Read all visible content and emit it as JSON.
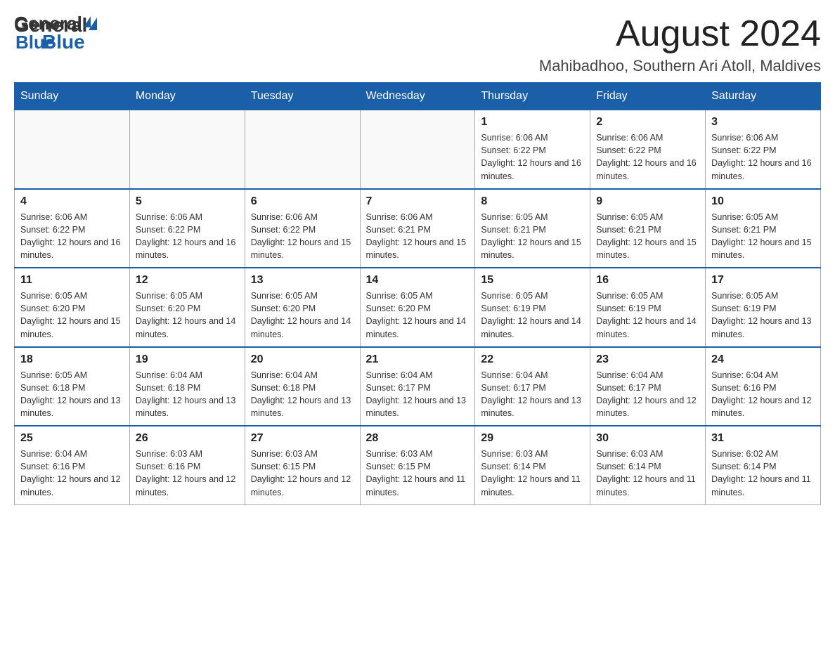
{
  "header": {
    "logo_general": "General",
    "logo_blue": "Blue",
    "month_title": "August 2024",
    "location": "Mahibadhoo, Southern Ari Atoll, Maldives"
  },
  "days_of_week": [
    "Sunday",
    "Monday",
    "Tuesday",
    "Wednesday",
    "Thursday",
    "Friday",
    "Saturday"
  ],
  "weeks": [
    [
      {
        "day": "",
        "sunrise": "",
        "sunset": "",
        "daylight": ""
      },
      {
        "day": "",
        "sunrise": "",
        "sunset": "",
        "daylight": ""
      },
      {
        "day": "",
        "sunrise": "",
        "sunset": "",
        "daylight": ""
      },
      {
        "day": "",
        "sunrise": "",
        "sunset": "",
        "daylight": ""
      },
      {
        "day": "1",
        "sunrise": "Sunrise: 6:06 AM",
        "sunset": "Sunset: 6:22 PM",
        "daylight": "Daylight: 12 hours and 16 minutes."
      },
      {
        "day": "2",
        "sunrise": "Sunrise: 6:06 AM",
        "sunset": "Sunset: 6:22 PM",
        "daylight": "Daylight: 12 hours and 16 minutes."
      },
      {
        "day": "3",
        "sunrise": "Sunrise: 6:06 AM",
        "sunset": "Sunset: 6:22 PM",
        "daylight": "Daylight: 12 hours and 16 minutes."
      }
    ],
    [
      {
        "day": "4",
        "sunrise": "Sunrise: 6:06 AM",
        "sunset": "Sunset: 6:22 PM",
        "daylight": "Daylight: 12 hours and 16 minutes."
      },
      {
        "day": "5",
        "sunrise": "Sunrise: 6:06 AM",
        "sunset": "Sunset: 6:22 PM",
        "daylight": "Daylight: 12 hours and 16 minutes."
      },
      {
        "day": "6",
        "sunrise": "Sunrise: 6:06 AM",
        "sunset": "Sunset: 6:22 PM",
        "daylight": "Daylight: 12 hours and 15 minutes."
      },
      {
        "day": "7",
        "sunrise": "Sunrise: 6:06 AM",
        "sunset": "Sunset: 6:21 PM",
        "daylight": "Daylight: 12 hours and 15 minutes."
      },
      {
        "day": "8",
        "sunrise": "Sunrise: 6:05 AM",
        "sunset": "Sunset: 6:21 PM",
        "daylight": "Daylight: 12 hours and 15 minutes."
      },
      {
        "day": "9",
        "sunrise": "Sunrise: 6:05 AM",
        "sunset": "Sunset: 6:21 PM",
        "daylight": "Daylight: 12 hours and 15 minutes."
      },
      {
        "day": "10",
        "sunrise": "Sunrise: 6:05 AM",
        "sunset": "Sunset: 6:21 PM",
        "daylight": "Daylight: 12 hours and 15 minutes."
      }
    ],
    [
      {
        "day": "11",
        "sunrise": "Sunrise: 6:05 AM",
        "sunset": "Sunset: 6:20 PM",
        "daylight": "Daylight: 12 hours and 15 minutes."
      },
      {
        "day": "12",
        "sunrise": "Sunrise: 6:05 AM",
        "sunset": "Sunset: 6:20 PM",
        "daylight": "Daylight: 12 hours and 14 minutes."
      },
      {
        "day": "13",
        "sunrise": "Sunrise: 6:05 AM",
        "sunset": "Sunset: 6:20 PM",
        "daylight": "Daylight: 12 hours and 14 minutes."
      },
      {
        "day": "14",
        "sunrise": "Sunrise: 6:05 AM",
        "sunset": "Sunset: 6:20 PM",
        "daylight": "Daylight: 12 hours and 14 minutes."
      },
      {
        "day": "15",
        "sunrise": "Sunrise: 6:05 AM",
        "sunset": "Sunset: 6:19 PM",
        "daylight": "Daylight: 12 hours and 14 minutes."
      },
      {
        "day": "16",
        "sunrise": "Sunrise: 6:05 AM",
        "sunset": "Sunset: 6:19 PM",
        "daylight": "Daylight: 12 hours and 14 minutes."
      },
      {
        "day": "17",
        "sunrise": "Sunrise: 6:05 AM",
        "sunset": "Sunset: 6:19 PM",
        "daylight": "Daylight: 12 hours and 13 minutes."
      }
    ],
    [
      {
        "day": "18",
        "sunrise": "Sunrise: 6:05 AM",
        "sunset": "Sunset: 6:18 PM",
        "daylight": "Daylight: 12 hours and 13 minutes."
      },
      {
        "day": "19",
        "sunrise": "Sunrise: 6:04 AM",
        "sunset": "Sunset: 6:18 PM",
        "daylight": "Daylight: 12 hours and 13 minutes."
      },
      {
        "day": "20",
        "sunrise": "Sunrise: 6:04 AM",
        "sunset": "Sunset: 6:18 PM",
        "daylight": "Daylight: 12 hours and 13 minutes."
      },
      {
        "day": "21",
        "sunrise": "Sunrise: 6:04 AM",
        "sunset": "Sunset: 6:17 PM",
        "daylight": "Daylight: 12 hours and 13 minutes."
      },
      {
        "day": "22",
        "sunrise": "Sunrise: 6:04 AM",
        "sunset": "Sunset: 6:17 PM",
        "daylight": "Daylight: 12 hours and 13 minutes."
      },
      {
        "day": "23",
        "sunrise": "Sunrise: 6:04 AM",
        "sunset": "Sunset: 6:17 PM",
        "daylight": "Daylight: 12 hours and 12 minutes."
      },
      {
        "day": "24",
        "sunrise": "Sunrise: 6:04 AM",
        "sunset": "Sunset: 6:16 PM",
        "daylight": "Daylight: 12 hours and 12 minutes."
      }
    ],
    [
      {
        "day": "25",
        "sunrise": "Sunrise: 6:04 AM",
        "sunset": "Sunset: 6:16 PM",
        "daylight": "Daylight: 12 hours and 12 minutes."
      },
      {
        "day": "26",
        "sunrise": "Sunrise: 6:03 AM",
        "sunset": "Sunset: 6:16 PM",
        "daylight": "Daylight: 12 hours and 12 minutes."
      },
      {
        "day": "27",
        "sunrise": "Sunrise: 6:03 AM",
        "sunset": "Sunset: 6:15 PM",
        "daylight": "Daylight: 12 hours and 12 minutes."
      },
      {
        "day": "28",
        "sunrise": "Sunrise: 6:03 AM",
        "sunset": "Sunset: 6:15 PM",
        "daylight": "Daylight: 12 hours and 11 minutes."
      },
      {
        "day": "29",
        "sunrise": "Sunrise: 6:03 AM",
        "sunset": "Sunset: 6:14 PM",
        "daylight": "Daylight: 12 hours and 11 minutes."
      },
      {
        "day": "30",
        "sunrise": "Sunrise: 6:03 AM",
        "sunset": "Sunset: 6:14 PM",
        "daylight": "Daylight: 12 hours and 11 minutes."
      },
      {
        "day": "31",
        "sunrise": "Sunrise: 6:02 AM",
        "sunset": "Sunset: 6:14 PM",
        "daylight": "Daylight: 12 hours and 11 minutes."
      }
    ]
  ]
}
